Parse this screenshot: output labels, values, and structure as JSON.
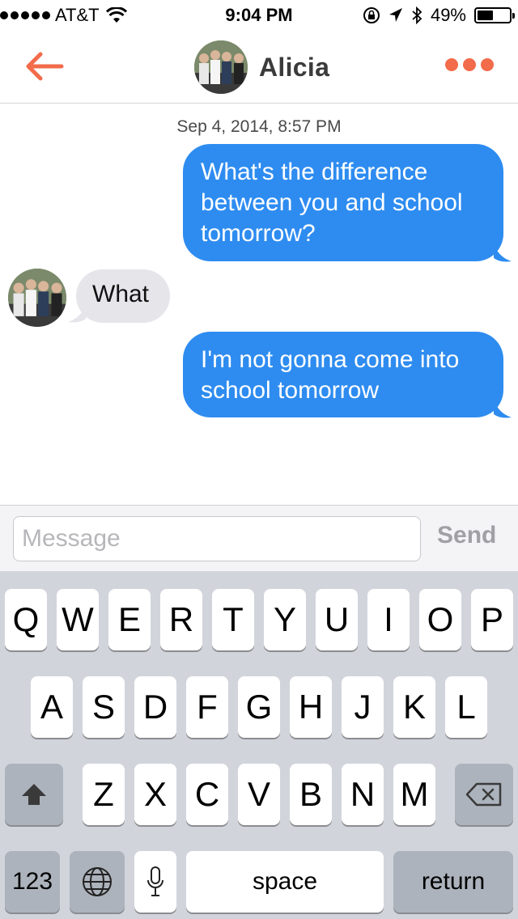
{
  "status_bar": {
    "carrier": "AT&T",
    "time": "9:04 PM",
    "battery": "49%",
    "battery_level": 0.49,
    "icons": [
      "signal-dots",
      "wifi-icon",
      "rotation-lock-icon",
      "location-arrow-icon",
      "bluetooth-icon",
      "battery-icon"
    ]
  },
  "nav": {
    "contact_name": "Alicia",
    "icons": [
      "back-arrow-icon",
      "more-dots-icon"
    ],
    "accent_color": "#f26b4a"
  },
  "conversation": {
    "timestamp": "Sep 4, 2014, 8:57 PM",
    "messages": [
      {
        "direction": "sent",
        "text": "What's the difference between you and school tomorrow?"
      },
      {
        "direction": "received",
        "text": "What"
      },
      {
        "direction": "sent",
        "text": "I'm not gonna come into school tomorrow"
      }
    ],
    "sent_color": "#2e8cf0",
    "received_color": "#e5e5ea"
  },
  "input": {
    "placeholder": "Message",
    "value": "",
    "send_label": "Send"
  },
  "keyboard": {
    "row1": [
      "Q",
      "W",
      "E",
      "R",
      "T",
      "Y",
      "U",
      "I",
      "O",
      "P"
    ],
    "row2": [
      "A",
      "S",
      "D",
      "F",
      "G",
      "H",
      "J",
      "K",
      "L"
    ],
    "row3": [
      "Z",
      "X",
      "C",
      "V",
      "B",
      "N",
      "M"
    ],
    "numbers_label": "123",
    "space_label": "space",
    "return_label": "return",
    "icons": [
      "shift-icon",
      "backspace-icon",
      "globe-icon",
      "microphone-icon"
    ]
  }
}
